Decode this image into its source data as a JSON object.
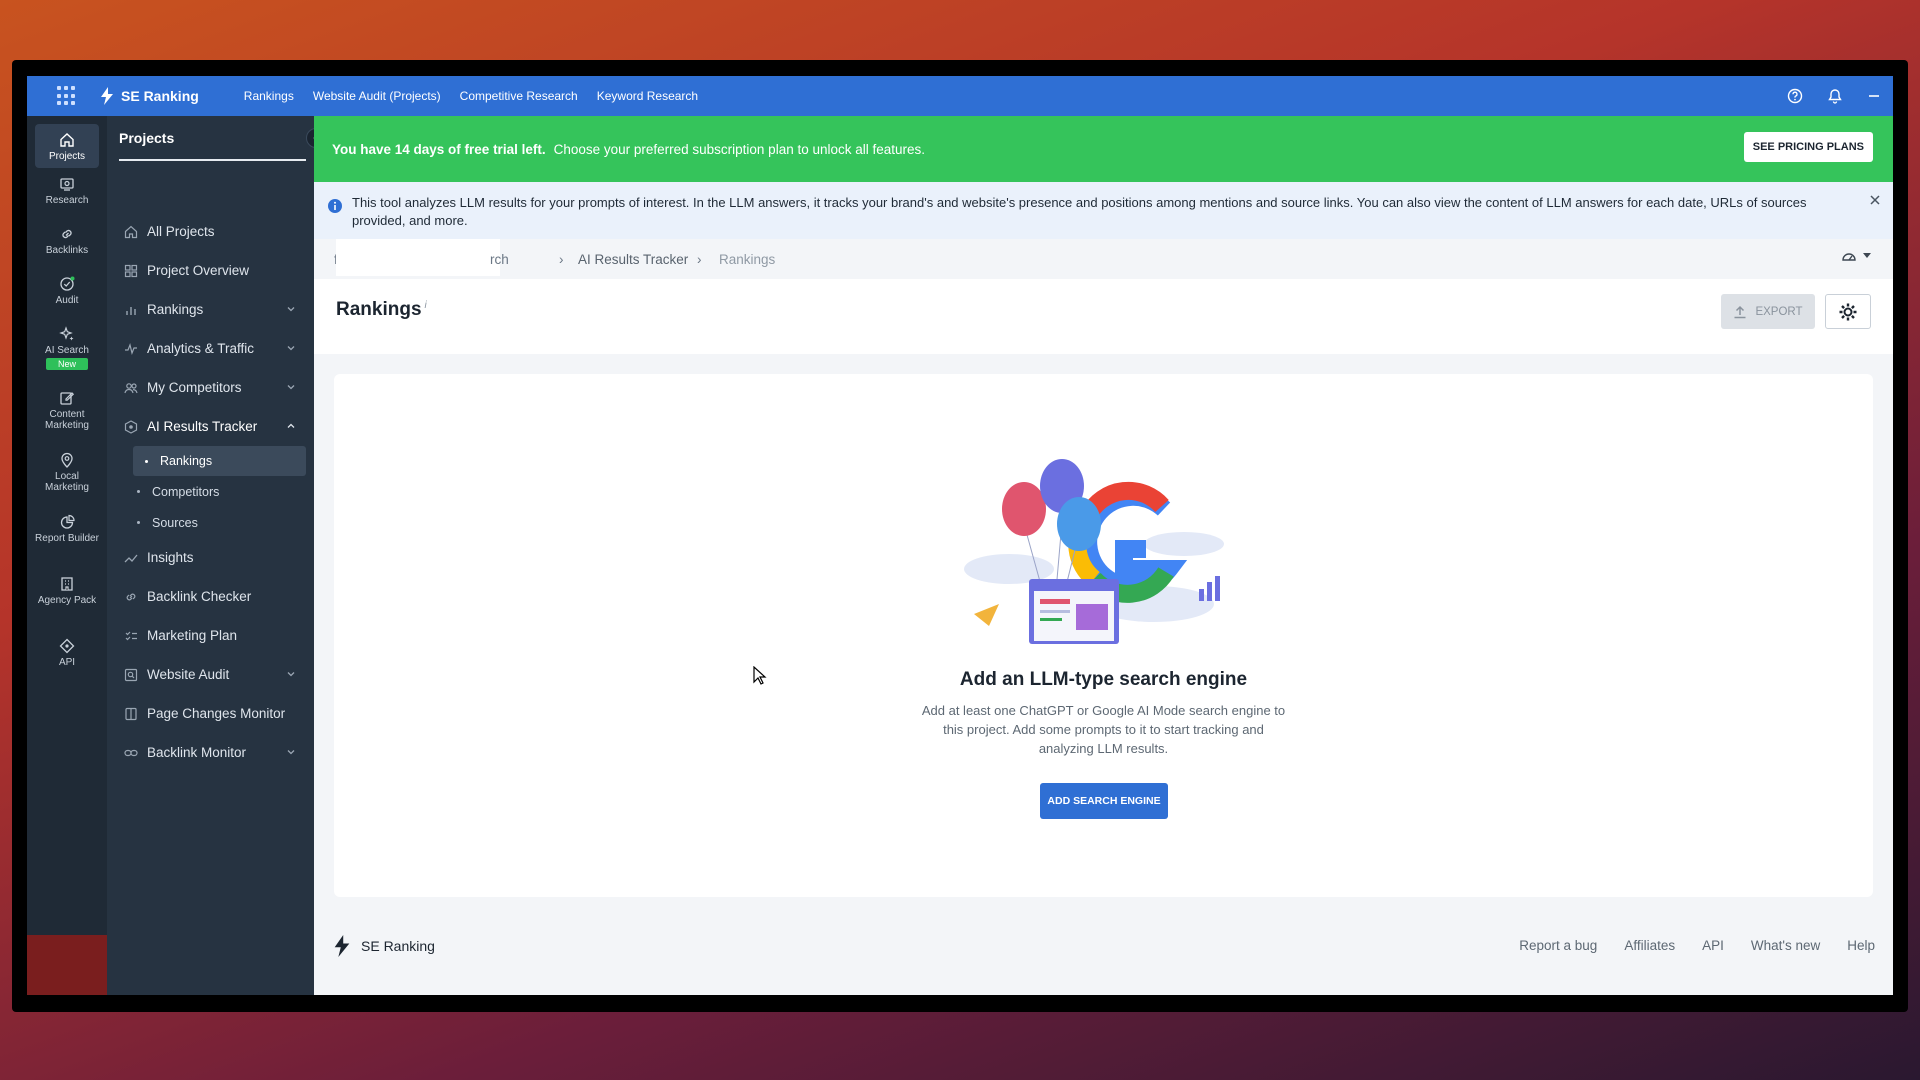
{
  "topbar": {
    "brand": "SE Ranking",
    "nav": [
      "Rankings",
      "Website Audit (Projects)",
      "Competitive Research",
      "Keyword Research"
    ]
  },
  "rail": {
    "items": [
      {
        "label": "Projects",
        "icon": "home-icon"
      },
      {
        "label": "Research",
        "icon": "research-icon"
      },
      {
        "label": "Backlinks",
        "icon": "link-icon"
      },
      {
        "label": "Audit",
        "icon": "audit-icon"
      },
      {
        "label": "AI Search",
        "icon": "sparkle-icon"
      },
      {
        "label": "Content Marketing",
        "icon": "edit-icon"
      },
      {
        "label": "Local Marketing",
        "icon": "pin-icon"
      },
      {
        "label": "Report Builder",
        "icon": "chart-pie-icon"
      },
      {
        "label": "Agency Pack",
        "icon": "building-icon"
      },
      {
        "label": "API",
        "icon": "api-icon"
      }
    ],
    "new_badge": "New"
  },
  "sidebar": {
    "title": "Projects",
    "items": [
      {
        "label": "All Projects"
      },
      {
        "label": "Project Overview"
      },
      {
        "label": "Rankings"
      },
      {
        "label": "Analytics & Traffic"
      },
      {
        "label": "My Competitors"
      },
      {
        "label": "AI Results Tracker"
      },
      {
        "label": "Insights"
      },
      {
        "label": "Backlink Checker"
      },
      {
        "label": "Marketing Plan"
      },
      {
        "label": "Website Audit"
      },
      {
        "label": "Page Changes Monitor"
      },
      {
        "label": "Backlink Monitor"
      }
    ],
    "subitems": [
      "Rankings",
      "Competitors",
      "Sources"
    ]
  },
  "trial": {
    "bold": "You have 14 days of free trial left.",
    "text": "Choose your preferred subscription plan to unlock all features.",
    "button": "SEE PRICING PLANS"
  },
  "info": {
    "text": "This tool analyzes LLM results for your prompts of interest. In the LLM answers, it tracks your brand's and website's presence and positions among mentions and source links. You can also view the content of LLM answers for each date, URLs of sources provided, and more."
  },
  "breadcrumbs": [
    "f",
    "rch",
    "AI Results Tracker",
    "Rankings"
  ],
  "header": {
    "title": "Rankings",
    "title_mark": "i",
    "export": "EXPORT"
  },
  "empty": {
    "title": "Add an LLM-type search engine",
    "desc": "Add at least one ChatGPT or Google AI Mode search engine to this project. Add some prompts to it to start tracking and analyzing LLM results.",
    "button": "ADD SEARCH ENGINE"
  },
  "footer": {
    "brand": "SE Ranking",
    "links": [
      "Report a bug",
      "Affiliates",
      "API",
      "What's new",
      "Help"
    ]
  },
  "colors": {
    "primary": "#2f6fd4",
    "trial_green": "#35c45b",
    "sidebar_dark": "#263341",
    "rail_dark": "#1f2a36"
  }
}
